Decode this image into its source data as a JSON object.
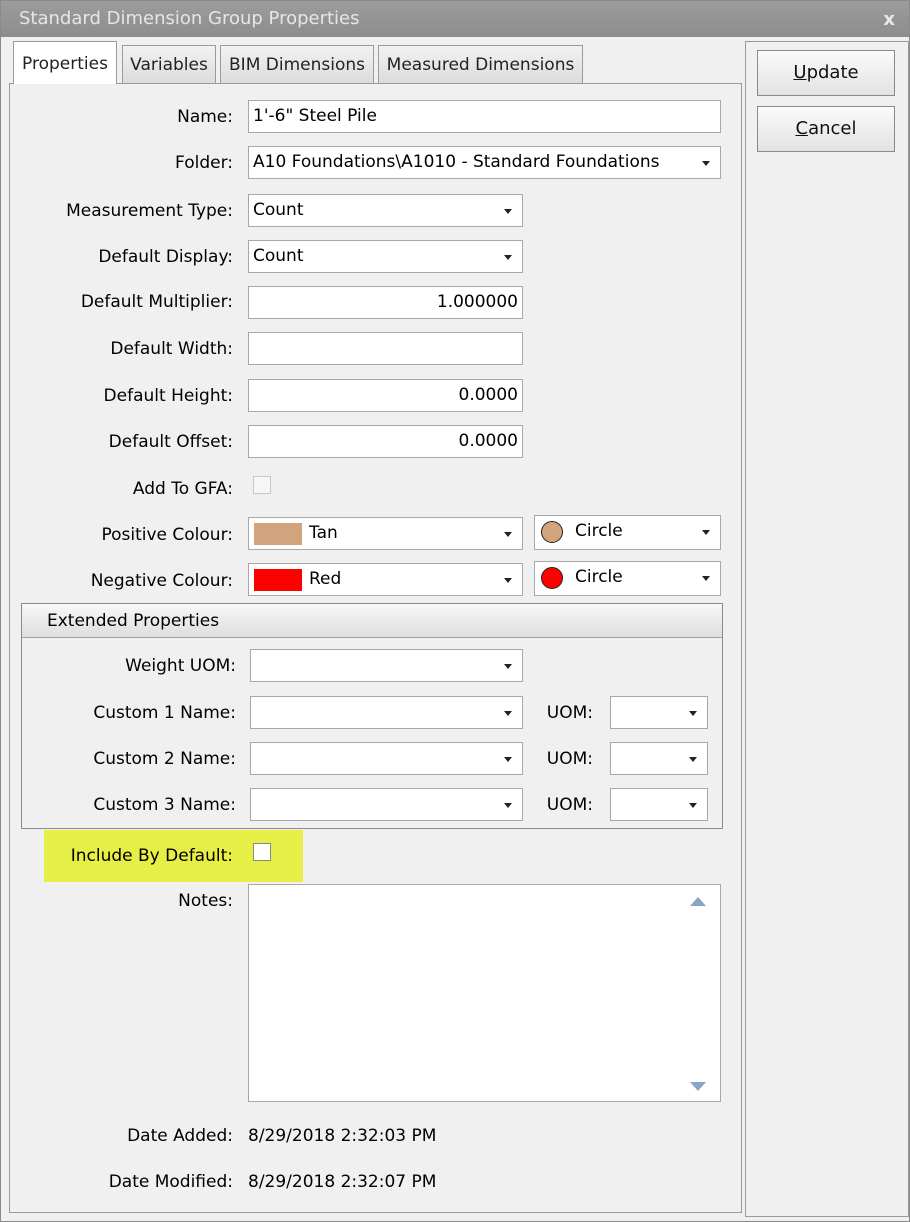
{
  "window": {
    "title": "Standard Dimension Group Properties",
    "close_glyph": "x"
  },
  "tabs": [
    {
      "label": "Properties",
      "active": true
    },
    {
      "label": "Variables",
      "active": false
    },
    {
      "label": "BIM Dimensions",
      "active": false
    },
    {
      "label": "Measured Dimensions",
      "active": false
    }
  ],
  "form": {
    "name": {
      "label": "Name:",
      "value": "1'-6\" Steel Pile"
    },
    "folder": {
      "label": "Folder:",
      "value": "A10 Foundations\\A1010 - Standard Foundations"
    },
    "measurement_type": {
      "label": "Measurement Type:",
      "value": "Count"
    },
    "default_display": {
      "label": "Default Display:",
      "value": "Count"
    },
    "default_multiplier": {
      "label": "Default Multiplier:",
      "value": "1.000000"
    },
    "default_width": {
      "label": "Default Width:",
      "value": ""
    },
    "default_height": {
      "label": "Default Height:",
      "value": "0.0000"
    },
    "default_offset": {
      "label": "Default Offset:",
      "value": "0.0000"
    },
    "add_to_gfa": {
      "label": "Add To GFA:",
      "checked": false,
      "enabled": false
    },
    "positive_colour": {
      "label": "Positive Colour:",
      "value": "Tan",
      "color": "#d2a47e",
      "shape": "Circle"
    },
    "negative_colour": {
      "label": "Negative Colour:",
      "value": "Red",
      "color": "#ff0000",
      "shape": "Circle"
    }
  },
  "extended": {
    "header": "Extended Properties",
    "weight_uom": {
      "label": "Weight UOM:",
      "value": ""
    },
    "customs": [
      {
        "label": "Custom 1 Name:",
        "value": "",
        "uom_label": "UOM:",
        "uom_value": ""
      },
      {
        "label": "Custom 2 Name:",
        "value": "",
        "uom_label": "UOM:",
        "uom_value": ""
      },
      {
        "label": "Custom 3 Name:",
        "value": "",
        "uom_label": "UOM:",
        "uom_value": ""
      }
    ]
  },
  "include_by_default": {
    "label": "Include By Default:",
    "checked": false,
    "highlight_color": "#e6ef45"
  },
  "notes": {
    "label": "Notes:",
    "value": ""
  },
  "dates": {
    "added_label": "Date Added:",
    "added_value": "8/29/2018 2:32:03 PM",
    "modified_label": "Date Modified:",
    "modified_value": "8/29/2018 2:32:07 PM"
  },
  "buttons": {
    "update": {
      "mnemonic": "U",
      "rest": "pdate"
    },
    "cancel": {
      "mnemonic": "C",
      "rest": "ancel"
    }
  }
}
